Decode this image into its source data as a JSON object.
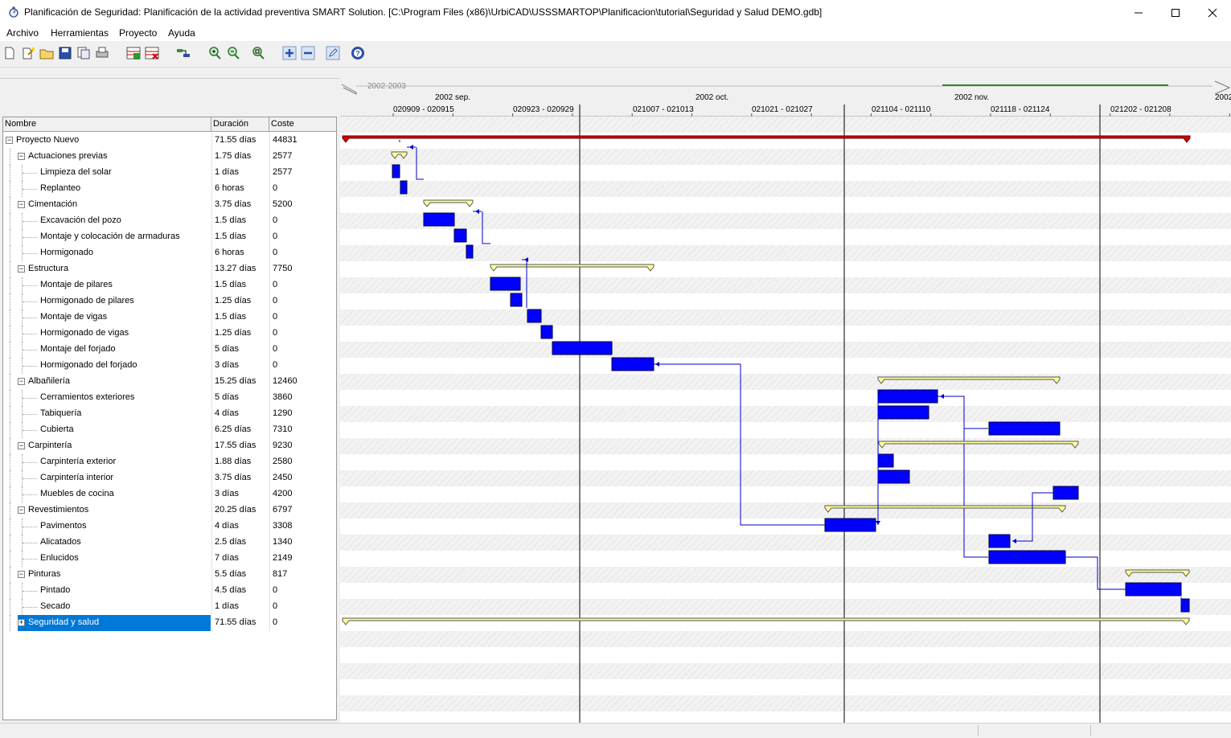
{
  "window": {
    "title": "Planificación de Seguridad: Planificación de la actividad preventiva SMART Solution. [C:\\Program Files (x86)\\UrbiCAD\\USSSMARTOP\\Planificacion\\tutorial\\Seguridad y Salud DEMO.gdb]",
    "minimize_icon": "minimize-icon",
    "maximize_icon": "maximize-icon",
    "close_icon": "close-icon"
  },
  "menu": [
    "Archivo",
    "Herramientas",
    "Proyecto",
    "Ayuda"
  ],
  "toolbar": [
    "new-icon",
    "wand-icon",
    "open-icon",
    "save-icon",
    "copy-icon",
    "print-icon",
    "add-task-icon",
    "delete-task-icon",
    "link-icon",
    "zoom-in-icon",
    "zoom-out-icon",
    "zoom-fit-icon",
    "plus-icon",
    "minus-icon",
    "edit-icon",
    "help-icon"
  ],
  "colors": {
    "task_bar": "#0000ff",
    "summary_bar": "#ffff99",
    "project_bar": "#d40000",
    "selection": "#0078d7",
    "link": "#0000cc"
  },
  "table": {
    "headers": {
      "name": "Nombre",
      "duration": "Duración",
      "cost": "Coste"
    },
    "rows": [
      {
        "name": "Proyecto Nuevo",
        "duration": "71.55 días",
        "cost": "44831",
        "level": 0,
        "expander": "minus"
      },
      {
        "name": "Actuaciones previas",
        "duration": "1.75 días",
        "cost": "2577",
        "level": 1,
        "expander": "minus"
      },
      {
        "name": "Limpieza del solar",
        "duration": "1 días",
        "cost": "2577",
        "level": 2
      },
      {
        "name": "Replanteo",
        "duration": "6 horas",
        "cost": "0",
        "level": 2
      },
      {
        "name": "Cimentación",
        "duration": "3.75 días",
        "cost": "5200",
        "level": 1,
        "expander": "minus"
      },
      {
        "name": "Excavación del pozo",
        "duration": "1.5 días",
        "cost": "0",
        "level": 2
      },
      {
        "name": "Montaje y colocación de armaduras",
        "duration": "1.5 días",
        "cost": "0",
        "level": 2
      },
      {
        "name": "Hormigonado",
        "duration": "6 horas",
        "cost": "0",
        "level": 2
      },
      {
        "name": "Estructura",
        "duration": "13.27 días",
        "cost": "7750",
        "level": 1,
        "expander": "minus"
      },
      {
        "name": "Montaje de pilares",
        "duration": "1.5 días",
        "cost": "0",
        "level": 2
      },
      {
        "name": "Hormigonado de pilares",
        "duration": "1.25 días",
        "cost": "0",
        "level": 2
      },
      {
        "name": "Montaje de vigas",
        "duration": "1.5 días",
        "cost": "0",
        "level": 2
      },
      {
        "name": "Hormigonado de vigas",
        "duration": "1.25 días",
        "cost": "0",
        "level": 2
      },
      {
        "name": "Montaje del forjado",
        "duration": "5 días",
        "cost": "0",
        "level": 2
      },
      {
        "name": "Hormigonado del forjado",
        "duration": "3 días",
        "cost": "0",
        "level": 2
      },
      {
        "name": "Albañilería",
        "duration": "15.25 días",
        "cost": "12460",
        "level": 1,
        "expander": "minus"
      },
      {
        "name": "Cerramientos exteriores",
        "duration": "5 días",
        "cost": "3860",
        "level": 2
      },
      {
        "name": "Tabiquería",
        "duration": "4 días",
        "cost": "1290",
        "level": 2
      },
      {
        "name": "Cubierta",
        "duration": "6.25 días",
        "cost": "7310",
        "level": 2
      },
      {
        "name": "Carpintería",
        "duration": "17.55 días",
        "cost": "9230",
        "level": 1,
        "expander": "minus"
      },
      {
        "name": "Carpintería exterior",
        "duration": "1.88 días",
        "cost": "2580",
        "level": 2
      },
      {
        "name": "Carpintería interior",
        "duration": "3.75 días",
        "cost": "2450",
        "level": 2
      },
      {
        "name": "Muebles de cocina",
        "duration": "3 días",
        "cost": "4200",
        "level": 2
      },
      {
        "name": "Revestimientos",
        "duration": "20.25 días",
        "cost": "6797",
        "level": 1,
        "expander": "minus"
      },
      {
        "name": "Pavimentos",
        "duration": "4 días",
        "cost": "3308",
        "level": 2
      },
      {
        "name": "Alicatados",
        "duration": "2.5 días",
        "cost": "1340",
        "level": 2
      },
      {
        "name": "Enlucidos",
        "duration": "7 días",
        "cost": "2149",
        "level": 2
      },
      {
        "name": "Pinturas",
        "duration": "5.5 días",
        "cost": "817",
        "level": 1,
        "expander": "minus"
      },
      {
        "name": "Pintado",
        "duration": "4.5 días",
        "cost": "0",
        "level": 2
      },
      {
        "name": "Secado",
        "duration": "1 días",
        "cost": "0",
        "level": 2
      },
      {
        "name": "Seguridad y salud",
        "duration": "71.55 días",
        "cost": "0",
        "level": 1,
        "expander": "plus",
        "selected": true
      }
    ]
  },
  "timeline": {
    "year_label": "2002-2003",
    "months": [
      "2002 sep.",
      "2002 oct.",
      "2002 nov.",
      "2002"
    ],
    "weeks": [
      "020909 - 020915",
      "020923 - 020929",
      "021007 - 021013",
      "021021 - 021027",
      "021104 - 021110",
      "021118 - 021124",
      "021202 - 021208"
    ]
  }
}
